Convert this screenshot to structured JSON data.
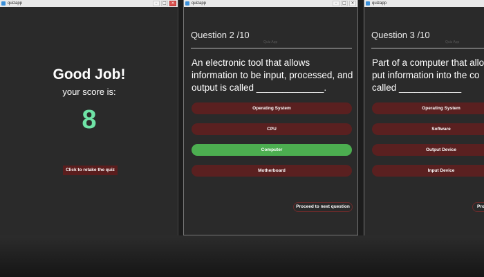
{
  "windows": {
    "result": {
      "title": "quizapp",
      "heading": "Good Job!",
      "score_label": "your score is:",
      "score": "8",
      "retake_label": "Click to retake the quiz"
    },
    "q2": {
      "title": "quizapp",
      "faint_title": "Quiz App",
      "header": "Question 2 /10",
      "question": "An electronic tool that allows\ninformation to be input, processed, and\noutput is called _____________.",
      "options": [
        "Operating System",
        "CPU",
        "Computer",
        "Motherboard"
      ],
      "selected_correct": "Computer",
      "next_label": "Proceed to next question"
    },
    "q3": {
      "title": "quizapp",
      "faint_title": "Quiz App",
      "header": "Question 3 /10",
      "question": "Part of a computer that allow\nput information into the co\ncalled ____________",
      "options": [
        "Operating System",
        "Software",
        "Output Device",
        "Input Device"
      ],
      "next_label": "Pro"
    }
  },
  "colors": {
    "window_bg": "#2a2a2a",
    "option_bg": "#5a2020",
    "correct_bg": "#4cae50",
    "score_color": "#6fe3a6"
  }
}
